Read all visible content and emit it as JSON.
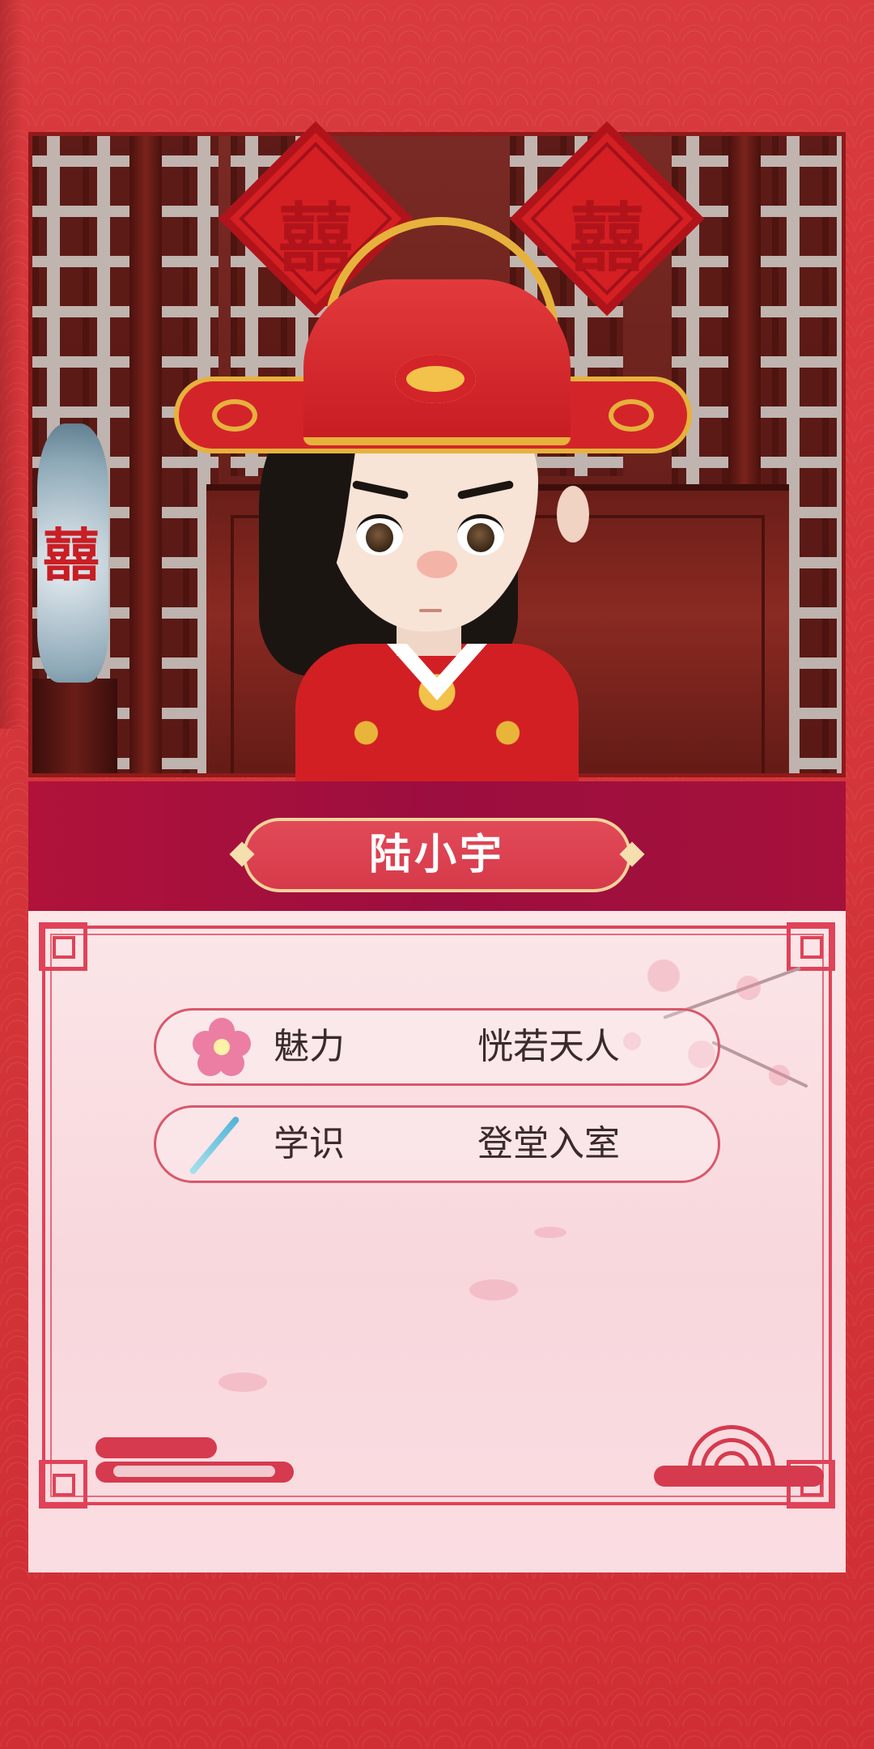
{
  "character": {
    "name": "陆小宇"
  },
  "decor": {
    "xi_char": "囍"
  },
  "stats": [
    {
      "icon": "plum-blossom-icon",
      "label": "魅力",
      "value": "恍若天人"
    },
    {
      "icon": "brush-icon",
      "label": "学识",
      "value": "登堂入室"
    }
  ],
  "colors": {
    "background_red": "#d8353a",
    "name_band": "#a5113a",
    "plaque": "#e24a58",
    "card_pink": "#fbe6e8",
    "frame_red": "#e04258",
    "gold": "#e6b23c"
  }
}
